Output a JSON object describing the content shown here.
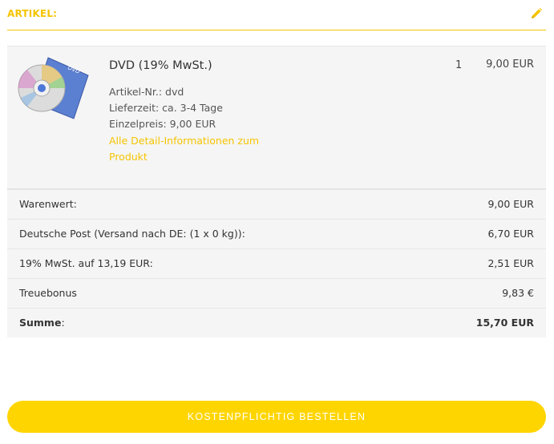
{
  "header": {
    "title": "ARTIKEL:",
    "edit_icon": "pencil-icon"
  },
  "colors": {
    "accent": "#f5c400",
    "button": "#ffd500",
    "panel": "#f5f5f5"
  },
  "item": {
    "image_icon": "dvd-product-image",
    "name": "DVD (19% MwSt.)",
    "article_no": "Artikel-Nr.: dvd",
    "delivery": "Lieferzeit: ca. 3-4 Tage",
    "unit_price": "Einzelpreis: 9,00 EUR",
    "detail_link": "Alle Detail-Informationen zum Produkt",
    "quantity": "1",
    "price": "9,00 EUR"
  },
  "summary": {
    "rows": [
      {
        "label": "Warenwert:",
        "value": "9,00 EUR"
      },
      {
        "label": "Deutsche Post (Versand nach DE: (1 x 0 kg)):",
        "value": "6,70 EUR"
      },
      {
        "label": "19% MwSt. auf 13,19 EUR:",
        "value": "2,51 EUR"
      },
      {
        "label": "Treuebonus",
        "value": "9,83 €"
      }
    ],
    "total_label": "Summe",
    "total_colon": ":",
    "total_value": "15,70 EUR"
  },
  "order_button": {
    "label": "KOSTENPFLICHTIG BESTELLEN"
  }
}
